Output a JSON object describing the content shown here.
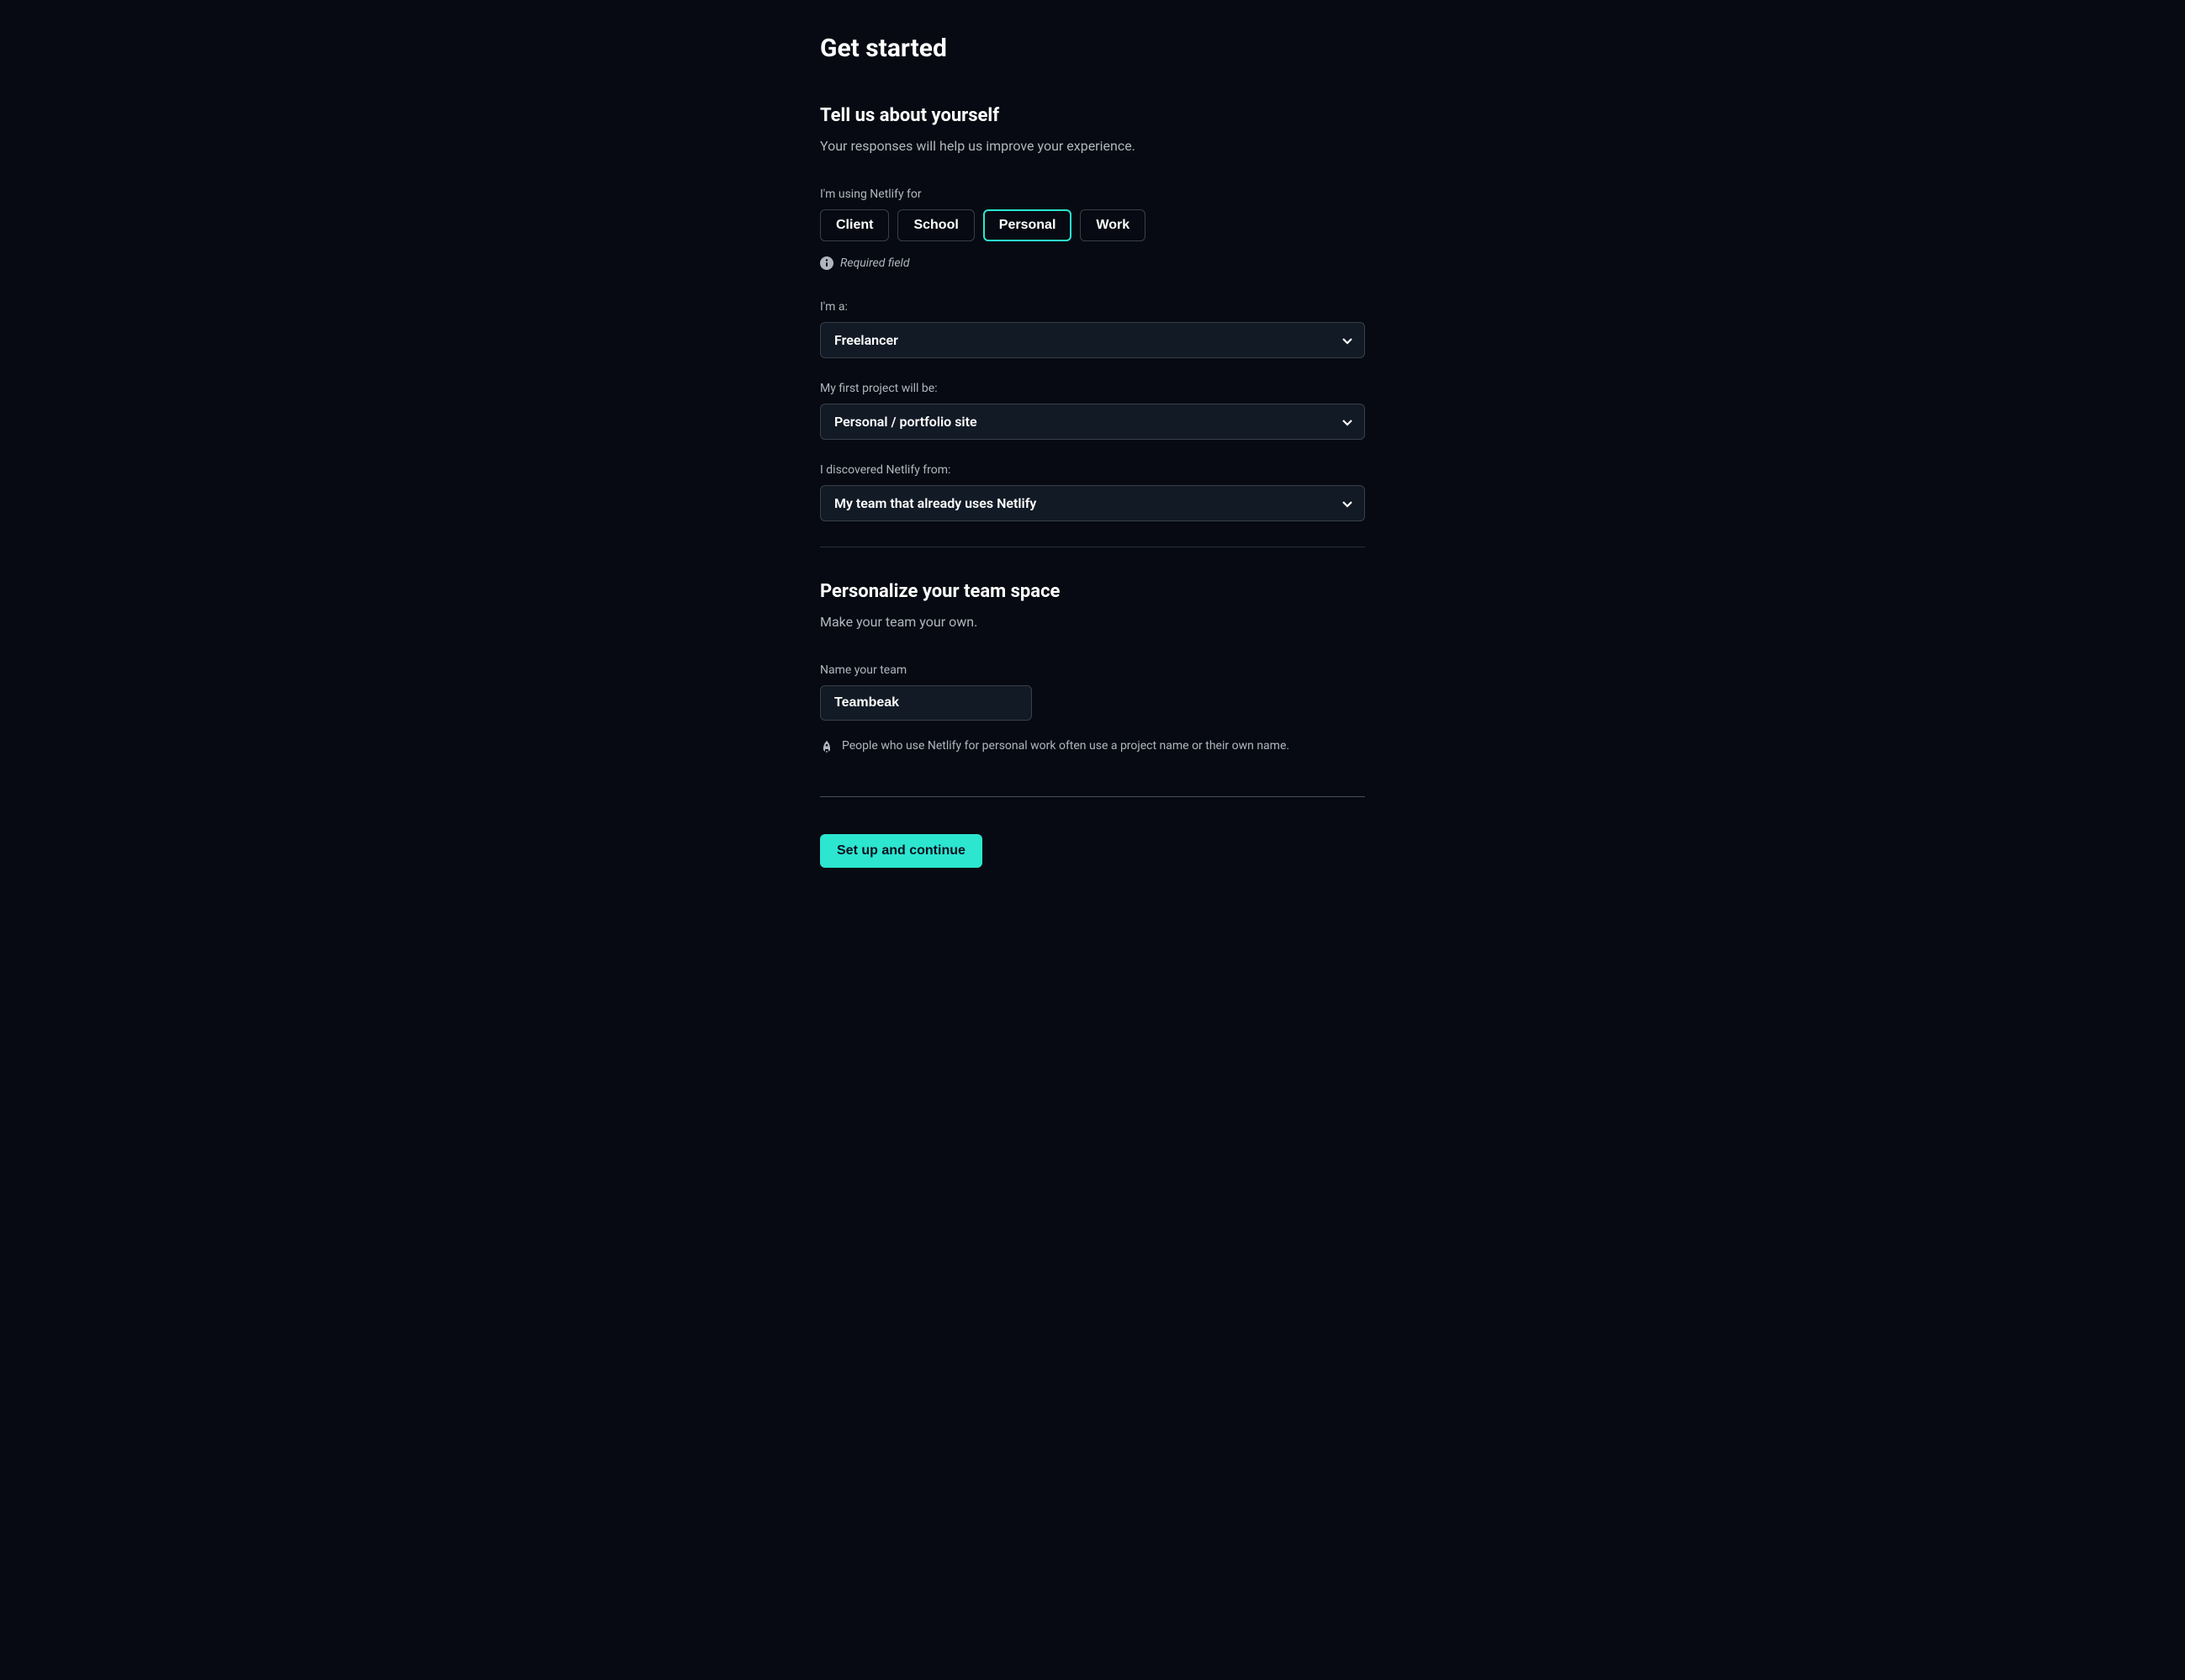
{
  "page_title": "Get started",
  "section1": {
    "title": "Tell us about yourself",
    "subtitle": "Your responses will help us improve your experience.",
    "using_for_label": "I'm using Netlify for",
    "pills": {
      "client": "Client",
      "school": "School",
      "personal": "Personal",
      "work": "Work"
    },
    "required_text": "Required field",
    "role": {
      "label": "I'm a:",
      "value": "Freelancer"
    },
    "project": {
      "label": "My first project will be:",
      "value": "Personal / portfolio site"
    },
    "discovered": {
      "label": "I discovered Netlify from:",
      "value": "My team that already uses Netlify"
    }
  },
  "section2": {
    "title": "Personalize your team space",
    "subtitle": "Make your team your own.",
    "team_name_label": "Name your team",
    "team_name_value": "Teambeak",
    "hint": "People who use Netlify for personal work often use a project name or their own name."
  },
  "submit_label": "Set up and continue",
  "colors": {
    "accent": "#2ce6d0",
    "background": "#070a12",
    "input_bg": "#121a25"
  }
}
